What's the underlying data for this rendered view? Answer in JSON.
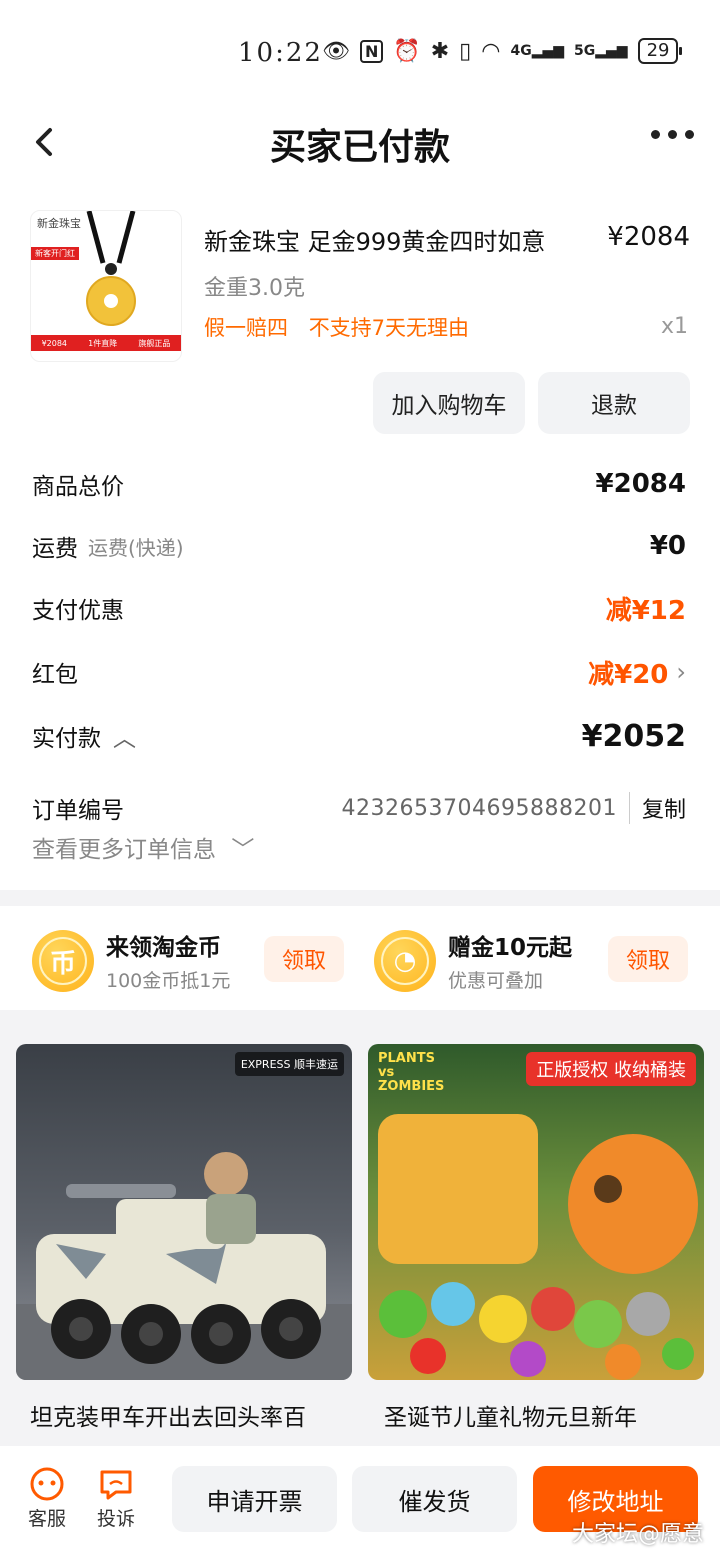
{
  "status": {
    "time": "10:22",
    "network1": "4G",
    "network2": "5G",
    "battery": "29"
  },
  "header": {
    "title": "买家已付款"
  },
  "product": {
    "thumb_brand": "新金珠宝",
    "thumb_tag": "新客开门红",
    "thumb_price": "¥2084",
    "thumb_badge1": "1件直降",
    "thumb_badge2": "旗舰正品",
    "name": "新金珠宝 足金999黄金四时如意",
    "price": "¥2084",
    "spec": "金重3.0克",
    "service1": "假一赔四",
    "service2": "不支持7天无理由",
    "qty": "x1",
    "add_cart": "加入购物车",
    "refund": "退款"
  },
  "summary": {
    "total_label": "商品总价",
    "total_value": "¥2084",
    "shipping_label": "运费",
    "shipping_sub": "运费(快递)",
    "shipping_value": "¥0",
    "discount_label": "支付优惠",
    "discount_value": "减¥12",
    "redpacket_label": "红包",
    "redpacket_value": "减¥20",
    "paid_label": "实付款",
    "paid_value": "¥2052",
    "order_label": "订单编号",
    "order_no": "4232653704695888201",
    "copy": "复制",
    "more_info": "查看更多订单信息"
  },
  "coins": {
    "c1_icon": "币",
    "c1_title": "来领淘金币",
    "c1_sub": "100金币抵1元",
    "c1_btn": "领取",
    "c2_title": "赠金10元起",
    "c2_sub": "优惠可叠加",
    "c2_btn": "领取"
  },
  "recommend": {
    "r1_badge": "EXPRESS 顺丰速运",
    "r1_title": "坦克装甲车开出去回头率百",
    "r2_badge": "正版授权 收纳桶装",
    "r2_logo": "PLANTS vs ZOMBIES",
    "r2_title": "圣诞节儿童礼物元旦新年"
  },
  "bottom": {
    "service": "客服",
    "complain": "投诉",
    "invoice": "申请开票",
    "urge": "催发货",
    "address": "修改地址"
  },
  "watermark": "大家坛@愿意"
}
